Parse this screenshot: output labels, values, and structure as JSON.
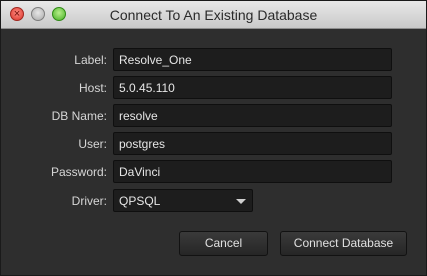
{
  "window": {
    "title": "Connect To An Existing Database"
  },
  "form": {
    "label": {
      "caption": "Label:",
      "value": "Resolve_One"
    },
    "host": {
      "caption": "Host:",
      "value": "5.0.45.110"
    },
    "db_name": {
      "caption": "DB Name:",
      "value": "resolve"
    },
    "user": {
      "caption": "User:",
      "value": "postgres"
    },
    "password": {
      "caption": "Password:",
      "value": "DaVinci"
    },
    "driver": {
      "caption": "Driver:",
      "value": "QPSQL"
    }
  },
  "buttons": {
    "cancel": "Cancel",
    "connect": "Connect Database"
  },
  "icons": {
    "close": "close-icon",
    "minimize": "minimize-icon",
    "maximize": "maximize-icon",
    "dropdown": "chevron-down-icon"
  },
  "colors": {
    "background": "#2e2e2e",
    "field": "#1d1d1d",
    "text": "#e6e6e6"
  }
}
